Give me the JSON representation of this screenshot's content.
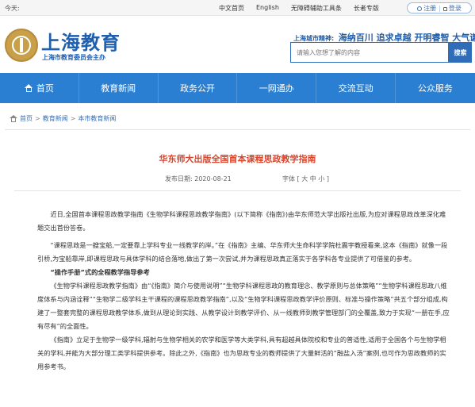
{
  "topbar": {
    "today_label": "今天:",
    "links": [
      "中文首页",
      "English",
      "无障碍辅助工具条",
      "长者专版"
    ],
    "register_label": "注册",
    "login_label": "登录"
  },
  "header": {
    "title": "上海教育",
    "subtitle": "上海市教育委员会主办",
    "spirit_label": "上海城市精神:",
    "spirit_values": "海纳百川 追求卓越 开明睿智 大气谦和",
    "search_placeholder": "请输入您想了解的内容",
    "search_button": "搜索"
  },
  "nav": {
    "items": [
      "首页",
      "教育新闻",
      "政务公开",
      "一网通办",
      "交流互动",
      "公众服务"
    ]
  },
  "breadcrumb": [
    "首页",
    "教育新闻",
    "本市教育新闻"
  ],
  "article": {
    "title": "华东师大出版全国首本课程思政教学指南",
    "date_label": "发布日期:",
    "date": "2020-08-21",
    "font_label": "字体",
    "font_big": "大",
    "font_mid": "中",
    "font_small": "小",
    "paragraphs": [
      "近日,全国首本课程思政教学指南《生物学科课程思政教学指南》(以下简称《指南》)由华东师范大学出版社出版,为应对课程思政改革深化难题交出首份答卷。",
      "“课程思政是一艘宝船,一定要靠上学科专业一线教学的岸。”在《指南》主编、华东师大生命科学学院杜震宇教授看来,这本《指南》就像一段引桥,为宝船靠岸,即课程思政与具体学科的结合落地,做出了第一次尝试,并为课程思政真正落实于各学科各专业提供了可借鉴的参考。",
      "“操作手册”式的全程教学指导参考",
      "《生物学科课程思政教学指南》由“《指南》简介与使用说明”“生物学科课程思政的教育理念、教学原则与总体策略”“生物学科课程思政八维度体系与内涵诠释”“生物学二级学科主干课程的课程思政教学指南”,以及“生物学科课程思政教学评价原则、标准与操作策略”共五个部分组成,构建了一整套完整的课程思政教学体系,做到从理论到实践、从教学设计到教学评价、从一线教师到教学管理部门的全覆盖,致力于实现“一册在手,应有尽有”的全面性。",
      "《指南》立足于生物学一级学科,辐射与生物学相关的农学和医学等大类学科,具有超越具体院校和专业的普适性,适用于全国各个与生物学相关的学科,并能为大部分理工类学科提供参考。除此之外,《指南》也为思政专业的教师提供了大量鲜活的“融盐入汤”案例,也可作为思政教师的实用参考书。"
    ]
  },
  "colors": {
    "nav_bg": "#2b7fd3",
    "brand": "#1f5fae",
    "title_red": "#d5462d",
    "link": "#3a6fb5"
  }
}
